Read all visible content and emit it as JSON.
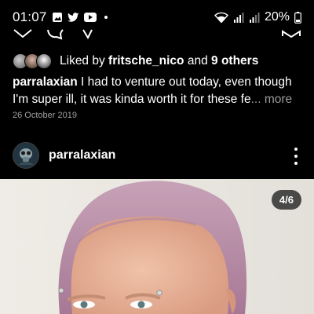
{
  "status_bar": {
    "time": "01:07",
    "battery_percent": "20%",
    "icons": [
      "gallery-icon",
      "twitter-icon",
      "youtube-icon",
      "notification-dot",
      "wifi-icon",
      "signal-icon",
      "signal-icon-2",
      "battery-icon"
    ]
  },
  "action_bar": {
    "icons": [
      "heart-icon",
      "comment-icon",
      "share-icon",
      "bookmark-icon"
    ]
  },
  "likes": {
    "prefix": "Liked by",
    "user": "fritsche_nico",
    "connector": "and",
    "others": "9 others"
  },
  "caption": {
    "username": "parralaxian",
    "text": "I had to venture out today, even though I'm super ill, it was kinda worth it for these fe",
    "more": "... more"
  },
  "post_date": "26 October 2019",
  "post": {
    "username": "parralaxian",
    "counter": "4/6"
  },
  "colors": {
    "background": "#000000",
    "text": "#ffffff",
    "muted": "#9a9a9a",
    "hair": "#b58aa6",
    "skin": "#e7b69a"
  }
}
